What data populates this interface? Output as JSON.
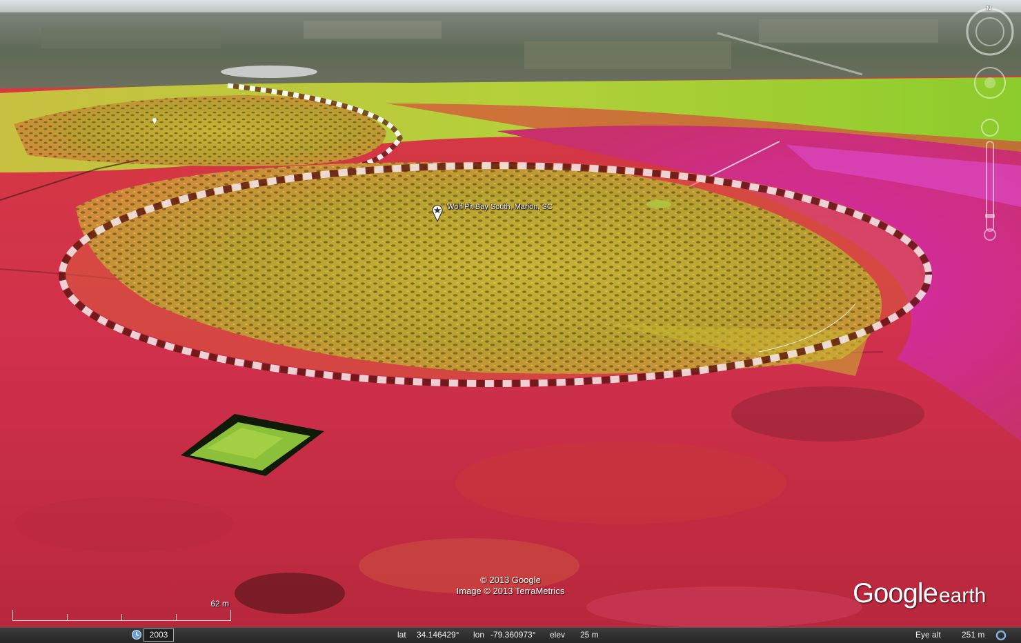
{
  "app": "Google Earth",
  "placemark": {
    "label": "Wolf Pit Bay South, Marion, SC"
  },
  "copyright": {
    "line1": "© 2013 Google",
    "line2": "Image © 2013 TerraMetrics"
  },
  "brand": {
    "word1": "Google",
    "word2": "earth"
  },
  "scale": {
    "label": "62 m"
  },
  "compass": {
    "north": "N"
  },
  "status": {
    "year": "2003",
    "lat_label": "lat",
    "lat_value": "34.146429°",
    "lon_label": "lon",
    "lon_value": "-79.360973°",
    "elev_label": "elev",
    "elev_value": "25 m",
    "eye_alt_label": "Eye alt",
    "eye_alt_value": "251 m"
  },
  "colors": {
    "terrain_red": "#d8304a",
    "terrain_magenta": "#d02aa0",
    "bay_yellow": "#c8b034",
    "field_green": "#9ccc30",
    "horizon_gray": "#8a8e88",
    "statusbar": "#2e2e2e"
  },
  "icons": {
    "placemark": "star-pin-icon",
    "history": "clock-history-icon",
    "streaming": "streaming-ring-icon",
    "compass": "compass-ring-icon"
  }
}
